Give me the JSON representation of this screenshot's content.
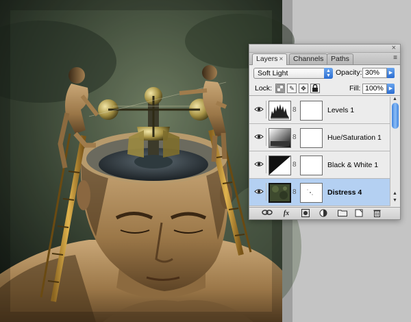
{
  "palette": {
    "tabs": [
      {
        "label": "Layers",
        "active": true,
        "close": "×"
      },
      {
        "label": "Channels",
        "active": false
      },
      {
        "label": "Paths",
        "active": false
      }
    ],
    "window_close": "×",
    "menu_icon": "≡",
    "blend_mode": "Soft Light",
    "opacity_label": "Opacity:",
    "opacity_value": "30%",
    "lock_label": "Lock:",
    "fill_label": "Fill:",
    "fill_value": "100%",
    "layers": [
      {
        "name": "Levels 1",
        "thumb": "histogram-icon",
        "visible": true,
        "selected": false
      },
      {
        "name": "Hue/Saturation 1",
        "thumb": "gradient-icon",
        "visible": true,
        "selected": false
      },
      {
        "name": "Black & White 1",
        "thumb": "diagonal-bw-icon",
        "visible": true,
        "selected": false
      },
      {
        "name": "Distress 4",
        "thumb": "texture-thumbnail",
        "visible": true,
        "selected": true
      }
    ],
    "bottom_icons": [
      "link-layers-icon",
      "fx-icon",
      "add-mask-icon",
      "adjustment-layer-icon",
      "new-group-icon",
      "new-layer-icon",
      "trash-icon"
    ],
    "fx_label": "fx"
  },
  "colors": {
    "accent": "#3f84e0",
    "selected_row": "#b4d0f2",
    "panel_bg": "#ececec",
    "canvas_gray": "#c4c4c4"
  }
}
